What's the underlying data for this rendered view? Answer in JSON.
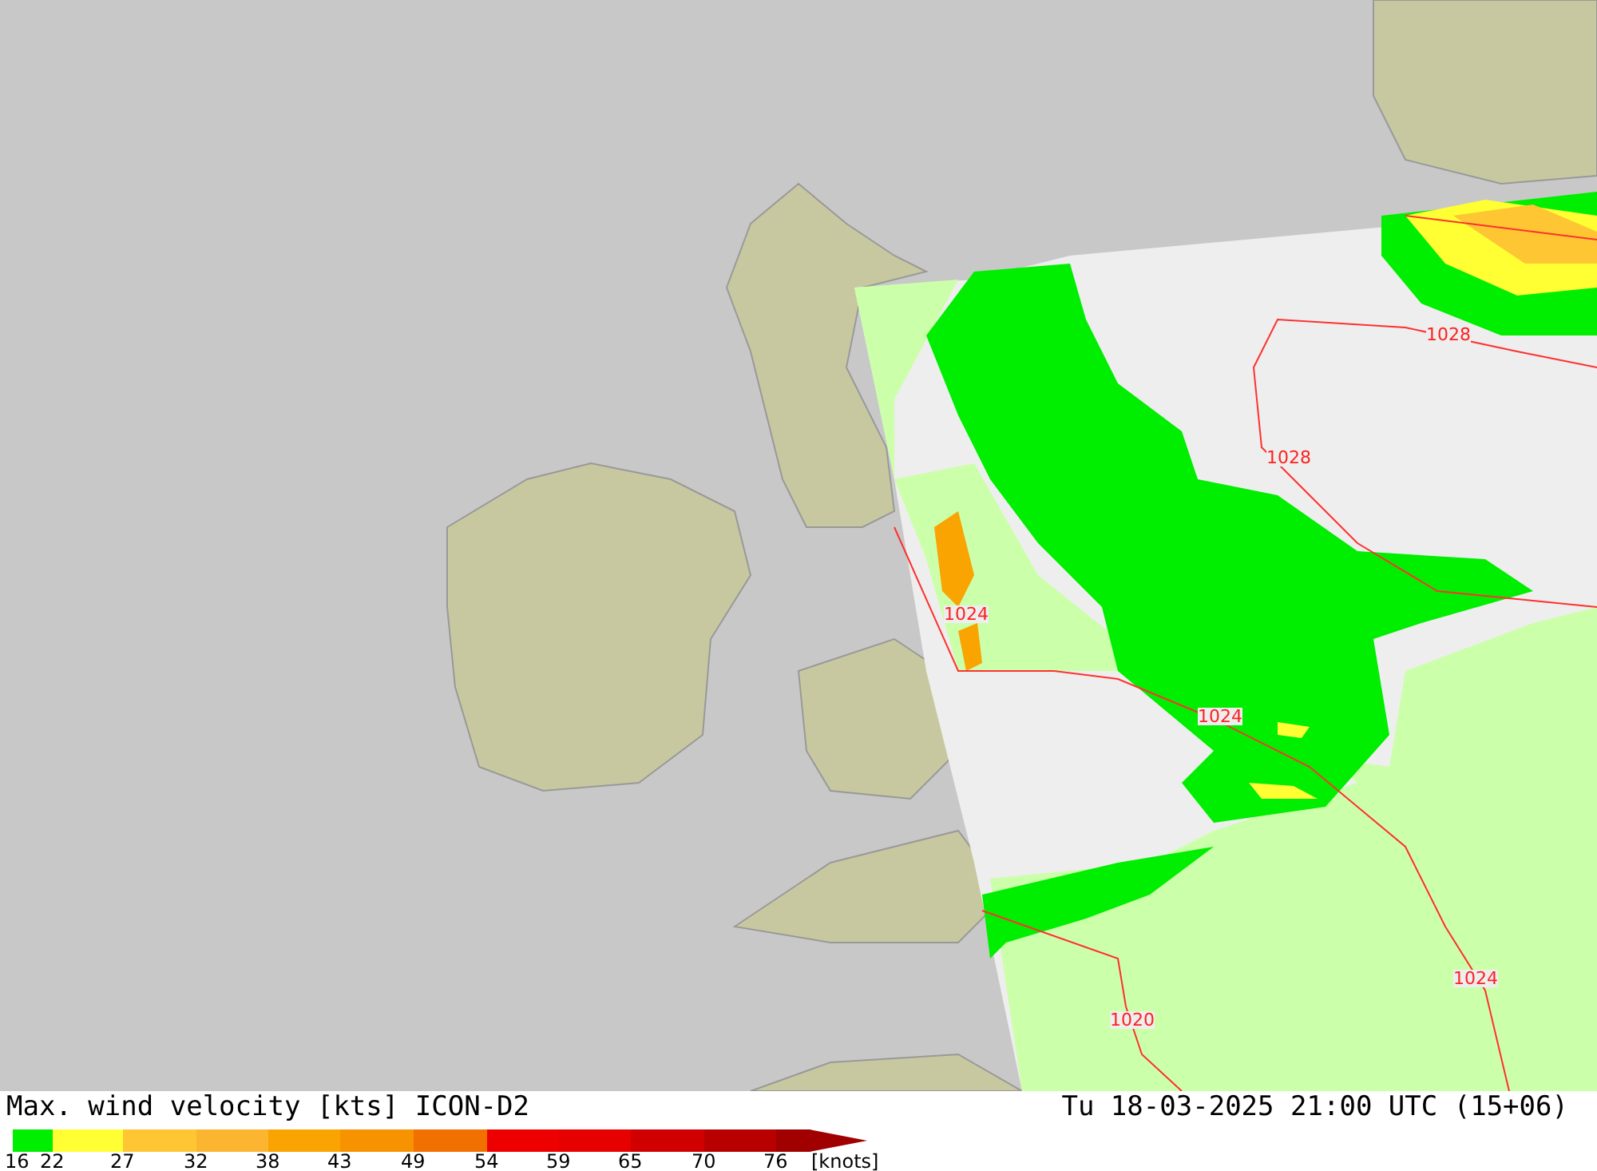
{
  "map": {
    "isobar_labels": [
      {
        "text": "1028"
      },
      {
        "text": "1028"
      },
      {
        "text": "1024"
      },
      {
        "text": "1024"
      },
      {
        "text": "1020"
      },
      {
        "text": "1024"
      }
    ]
  },
  "legend": {
    "title": "Max. wind velocity [kts] ICON-D2",
    "timestamp": "Tu 18-03-2025 21:00 UTC (15+06)",
    "bins": [
      {
        "color": "#00ee00"
      },
      {
        "color": "#ffff33"
      },
      {
        "color": "#fdc632"
      },
      {
        "color": "#fbb530"
      },
      {
        "color": "#f9a400"
      },
      {
        "color": "#f79200"
      },
      {
        "color": "#f27000"
      },
      {
        "color": "#ee0000"
      },
      {
        "color": "#e60000"
      },
      {
        "color": "#d00000"
      },
      {
        "color": "#b80000"
      },
      {
        "color": "#a00000"
      }
    ],
    "ticks": [
      "16",
      "22",
      "27",
      "32",
      "38",
      "43",
      "49",
      "54",
      "59",
      "65",
      "70",
      "76"
    ],
    "units": "[knots]"
  }
}
